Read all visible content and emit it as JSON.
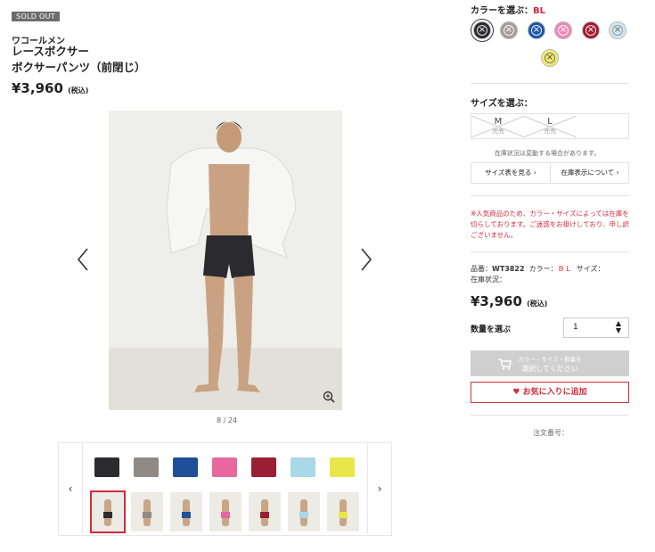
{
  "product": {
    "badge": "SOLD OUT",
    "brand": "ワコールメン",
    "title_line1": "レースボクサー",
    "title_line2": "ボクサーパンツ（前閉じ）",
    "price": "¥3,960",
    "tax_note": "(税込)"
  },
  "gallery": {
    "counter": "8 / 24",
    "prev_icon": "chevron-left-icon",
    "next_icon": "chevron-right-icon",
    "zoom_icon": "zoom-in-icon"
  },
  "thumbs": {
    "prev": "‹",
    "next": "›",
    "swatches": [
      "#2b2b2d",
      "#8f8a86",
      "#1e4f9a",
      "#e8679e",
      "#9a1f33",
      "#a9d8e6",
      "#e9e64a"
    ],
    "photo_briefs": [
      "#2b2b2d",
      "#8f8a86",
      "#1e4f9a",
      "#e8679e",
      "#9a1f33",
      "#a9d8e6",
      "#e9e64a"
    ]
  },
  "color": {
    "label": "カラーを選ぶ：",
    "selected": "BL",
    "options": [
      "#2a2a2e",
      "#a59c97",
      "#1f56a6",
      "#ef87b6",
      "#a3192d",
      "#cfe8ef",
      "#f0ea6c"
    ]
  },
  "size": {
    "label": "サイズを選ぶ：",
    "options": [
      {
        "name": "M",
        "status": "完売"
      },
      {
        "name": "L",
        "status": "完売"
      }
    ],
    "stock_note": "在庫状況は変動する場合があります。",
    "chart_button": "サイズ表を見る",
    "stock_button": "在庫表示について"
  },
  "warning": "※人気商品のため、カラー・サイズによっては在庫を切らしております。ご迷惑をお掛けしており、申し訳ございません。",
  "meta": {
    "sku_label": "品番：",
    "sku": "WT3822",
    "color_label": "カラー：",
    "color": "ＢＬ",
    "size_label": "サイズ：",
    "stock_label": "在庫状況："
  },
  "purchase": {
    "price": "¥3,960",
    "tax_note": "(税込)",
    "qty_label": "数量を選ぶ",
    "qty_value": "1",
    "cart_line1": "カラー・サイズ・数量を",
    "cart_line2": "選択してください",
    "favorite": "お気に入りに追加",
    "order_no": "注文番号："
  },
  "colors": {
    "accent_red": "#d22c3a",
    "disabled": "#cfcfcf"
  }
}
